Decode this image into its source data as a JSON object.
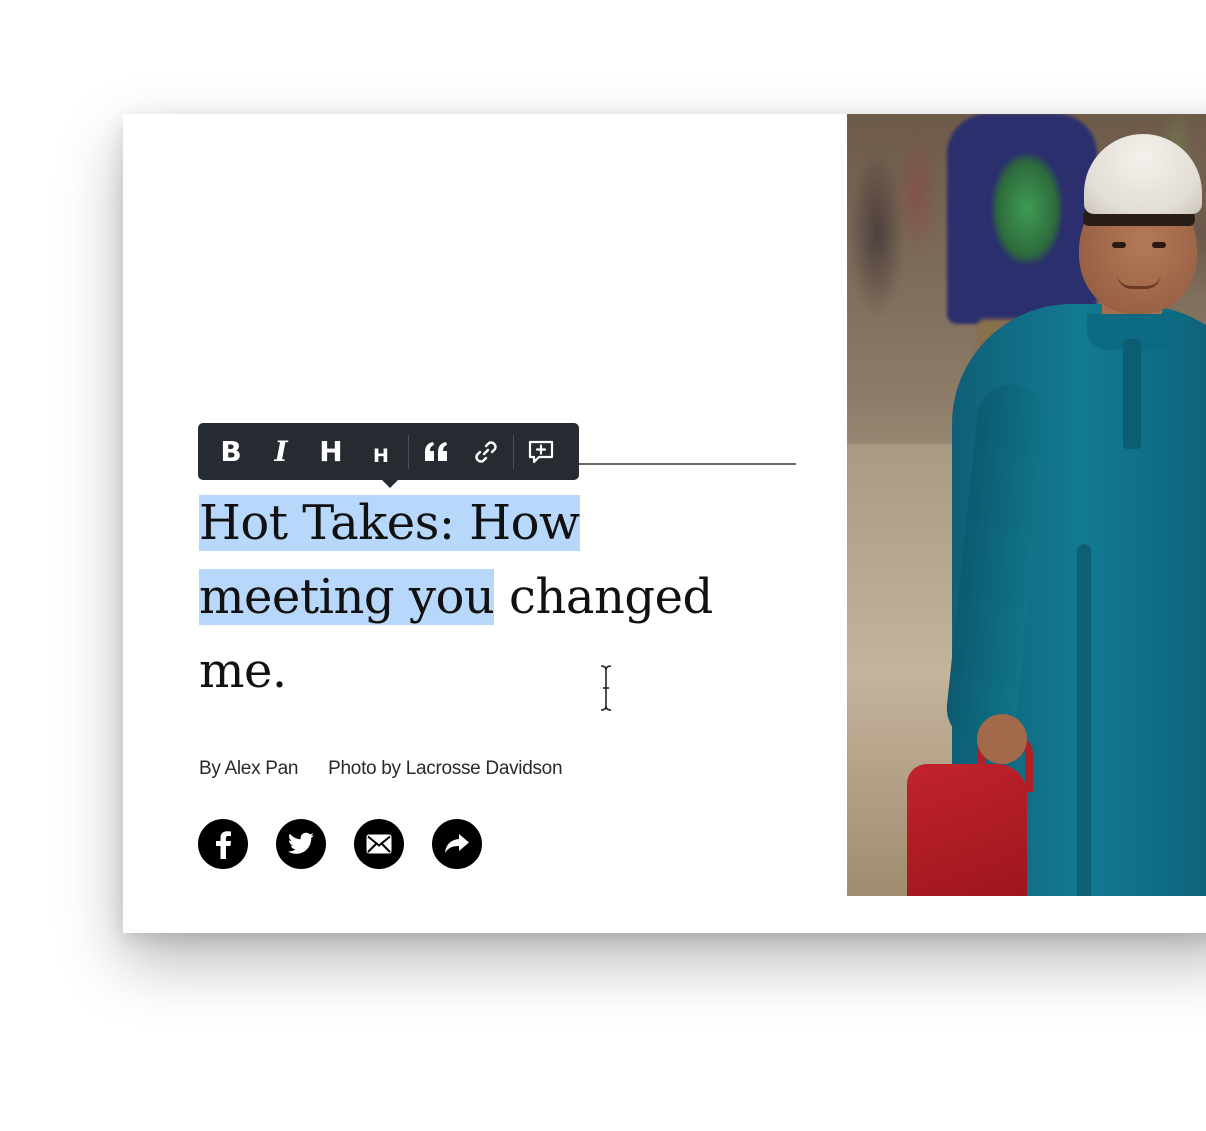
{
  "toolbar": {
    "buttons": [
      {
        "label": "B",
        "icon": "bold-icon"
      },
      {
        "label": "I",
        "icon": "italic-icon"
      },
      {
        "label": "H",
        "icon": "heading-large-icon"
      },
      {
        "label": "H",
        "icon": "heading-small-icon"
      },
      {
        "icon": "quote-icon"
      },
      {
        "icon": "link-icon"
      },
      {
        "icon": "add-comment-icon"
      }
    ]
  },
  "headline": {
    "selected_part_1": "Hot Takes: How",
    "selected_part_2": "meeting you",
    "rest": " changed me."
  },
  "byline": {
    "author": "By Alex Pan",
    "photo_credit": "Photo by Lacrosse Davidson"
  },
  "share": [
    {
      "icon": "facebook-icon"
    },
    {
      "icon": "twitter-icon"
    },
    {
      "icon": "email-icon"
    },
    {
      "icon": "share-icon"
    }
  ],
  "colors": {
    "selection": "#b7d7fb",
    "toolbar_bg": "#262b32",
    "text": "#111111"
  }
}
